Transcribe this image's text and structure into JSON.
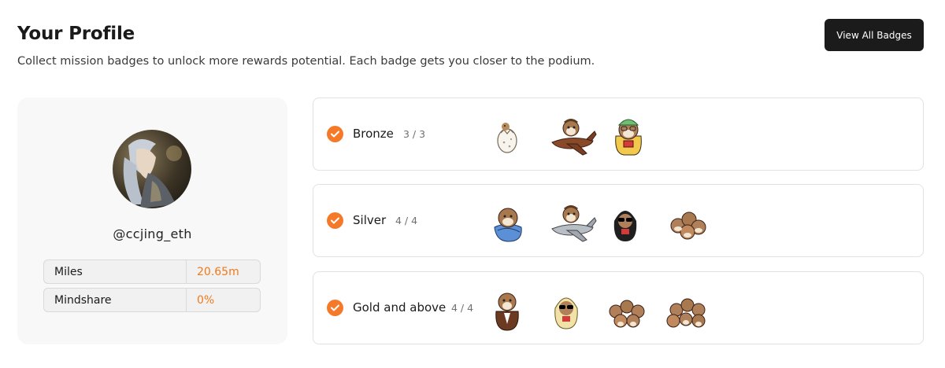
{
  "header": {
    "title": "Your Profile",
    "subtitle": "Collect mission badges to unlock more rewards potential. Each badge gets you closer to the podium.",
    "view_all_label": "View All Badges"
  },
  "profile": {
    "handle": "@ccjing_eth",
    "stats": [
      {
        "label": "Miles",
        "value": "20.65m"
      },
      {
        "label": "Mindshare",
        "value": "0%"
      }
    ]
  },
  "tiers": [
    {
      "name": "Bronze",
      "count": "3 / 3",
      "completed": true,
      "badges": [
        "egg-badge-icon",
        "pilot-plane-badge-icon",
        "green-hat-bird-badge-icon"
      ]
    },
    {
      "name": "Silver",
      "count": "4 / 4",
      "completed": true,
      "badges": [
        "blanket-bird-badge-icon",
        "silver-plane-badge-icon",
        "hooded-sunglasses-bird-badge-icon",
        "bird-group-badge-icon"
      ]
    },
    {
      "name": "Gold and above",
      "count": "4 / 4",
      "completed": true,
      "badges": [
        "suited-bird-badge-icon",
        "yellow-hood-bird-badge-icon",
        "bird-crowd-badge-icon",
        "bird-pile-badge-icon"
      ]
    }
  ],
  "colors": {
    "accent": "#f47a2a",
    "stat_value": "#f07a1a",
    "button_bg": "#1b1b1b"
  }
}
